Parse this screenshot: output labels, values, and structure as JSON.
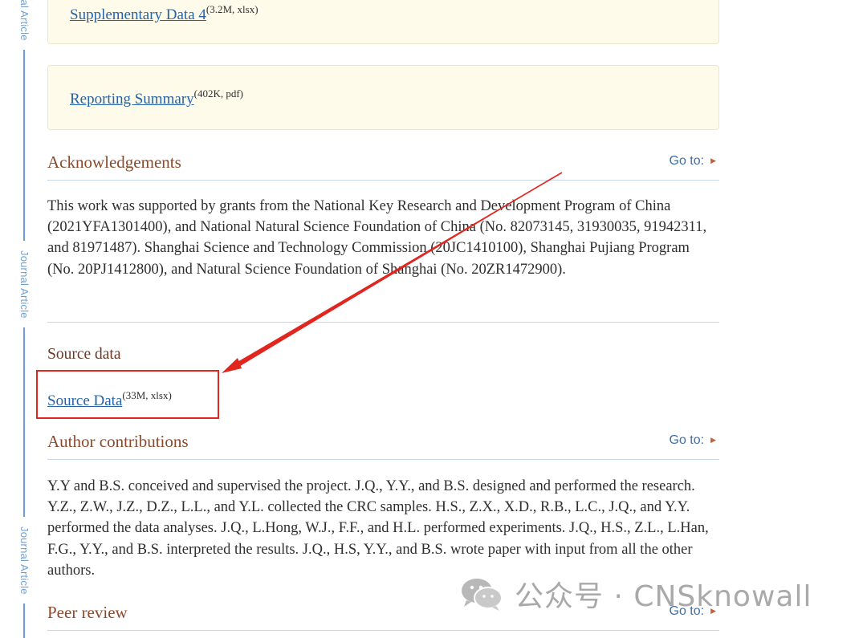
{
  "rail": {
    "label": "Journal Article"
  },
  "supplementary": [
    {
      "link": "Supplementary Data 4",
      "meta": "(3.2M, xlsx)"
    },
    {
      "link": "Reporting Summary",
      "meta": "(402K, pdf)"
    }
  ],
  "acknowledgements": {
    "title": "Acknowledgements",
    "goto": "Go to:",
    "text": "This work was supported by grants from the National Key Research and Development Program of China (2021YFA1301400), and National Natural Science Foundation of China (No. 82073145, 31930035, 91942311, and 81971487). Shanghai Science and Technology Commission (20JC1410100), Shanghai Pujiang Program (No. 20PJ1412800), and Natural Science Foundation of Shanghai (No. 20ZR1472900)."
  },
  "source_data": {
    "title": "Source data",
    "link": "Source Data",
    "meta": "(33M, xlsx)"
  },
  "author_contributions": {
    "title": "Author contributions",
    "goto": "Go to:",
    "text": "Y.Y and B.S. conceived and supervised the project. J.Q., Y.Y., and B.S. designed and performed the research. Y.Z., Z.W., J.Z., D.Z., L.L., and Y.L. collected the CRC samples. H.S., Z.X., X.D., R.B., L.C., J.Q., and Y.Y. performed the data analyses. J.Q., L.Hong, W.J., F.F., and H.L. performed experiments. J.Q., H.S., Z.L., L.Han, F.G., Y.Y., and B.S. interpreted the results. J.Q., H.S, Y.Y., and B.S. wrote paper with input from all the other authors."
  },
  "peer_review": {
    "title": "Peer review",
    "goto": "Go to:"
  },
  "watermark": {
    "text": "公众号 · CNSknowall",
    "icon": "wechat-icon"
  },
  "colors": {
    "link": "#2563a6",
    "section_title": "#8a4a2c",
    "rail": "#6f9fd0",
    "annotation_red": "#e0261f",
    "supp_box_bg": "#fefbea"
  }
}
